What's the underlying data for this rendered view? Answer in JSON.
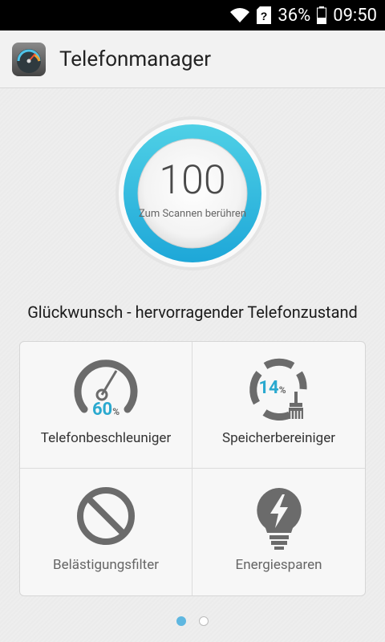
{
  "status_bar": {
    "battery": "36%",
    "time": "09:50",
    "icons": [
      "wifi-icon",
      "sim-unknown-icon",
      "battery-icon"
    ]
  },
  "app": {
    "title": "Telefonmanager",
    "icon": "speedometer-app-icon"
  },
  "score": {
    "value": "100",
    "hint": "Zum Scannen berühren",
    "ring_color": "#2bb6d8"
  },
  "status_message": "Glückwunsch - hervorragender Telefonzustand",
  "tiles": [
    {
      "label": "Telefonbeschleuniger",
      "icon": "gauge-icon",
      "percent": "60",
      "unit": "%"
    },
    {
      "label": "Speicherbereiniger",
      "icon": "broom-icon",
      "percent": "14",
      "unit": "%"
    },
    {
      "label": "Belästigungsfilter",
      "icon": "block-icon"
    },
    {
      "label": "Energiesparen",
      "icon": "lightbulb-bolt-icon"
    }
  ],
  "pager": {
    "count": 2,
    "active": 0
  },
  "colors": {
    "accent": "#2aa9cf",
    "icon_gray": "#6b6b6b"
  }
}
